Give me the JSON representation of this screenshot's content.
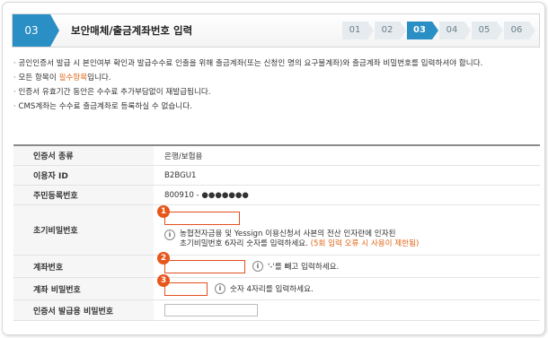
{
  "header": {
    "step_number": "03",
    "title": "보안매체/출금계좌번호 입력",
    "steps": [
      "01",
      "02",
      "03",
      "04",
      "05",
      "06"
    ],
    "active_step": "03"
  },
  "notices": {
    "line1": "공인인증서 발급 시 본인여부 확인과 발급수수료 인출을 위해 출금계좌(또는 신청인 명의 요구불계좌)와 출금계좌 비밀번호를 입력하셔야 합니다.",
    "line2_prefix": "모든 항목이 ",
    "line2_required": "필수항목",
    "line2_suffix": "입니다.",
    "line3": "인증서 유효기간 동안은 수수료 추가부담없이 재발급됩니다.",
    "line4": "CMS계좌는 수수료 출금계좌로 등록하실 수 없습니다."
  },
  "form": {
    "cert_type_label": "인증서 종류",
    "cert_type_value": "은행/보험용",
    "user_id_label": "이용자 ID",
    "user_id_value": "B2BGU1",
    "rrn_label": "주민등록번호",
    "rrn_value": "800910 - ●●●●●●●",
    "initial_pw_label": "초기비밀번호",
    "initial_pw_help1": "농협전자금융 및 Yessign 이용신청서 사본의 전산 인자란에 인자된",
    "initial_pw_help2": "초기비밀번호 6자리 숫자를 입력하세요.",
    "initial_pw_warning": "(5회 입력 오류 시 사용이 제한됨)",
    "account_label": "계좌번호",
    "account_help": "'-'를 빼고 입력하세요.",
    "account_pw_label": "계좌 비밀번호",
    "account_pw_help": "숫자 4자리를 입력하세요.",
    "cert_pw_label": "인증서 발급용 비밀번호"
  },
  "badges": [
    "1",
    "2",
    "3"
  ],
  "colors": {
    "accent": "#2a8fc4",
    "highlight": "#e8561c",
    "required": "#e1661a"
  }
}
